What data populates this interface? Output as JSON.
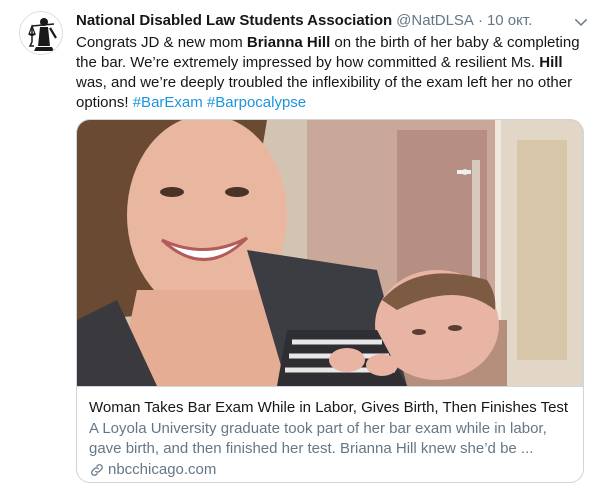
{
  "tweet": {
    "author_name": "National Disabled Law Students Association",
    "author_handle": "@NatDLSA",
    "separator": "·",
    "date": "10 окт.",
    "text_1": "Congrats JD & new mom ",
    "bold_1": "Brianna Hill",
    "text_2": " on the birth of her baby & completing the bar. We’re extremely impressed by how committed & resilient Ms. ",
    "bold_2": "Hill",
    "text_3": " was, and we’re deeply troubled the inflexibility of the exam left her no other options! ",
    "hashtag_1": "#BarExam",
    "hashtag_2": "#Barpocalypse"
  },
  "card": {
    "title": "Woman Takes Bar Exam While in Labor, Gives Birth, Then Finishes Test",
    "description": "A Loyola University graduate took part of her bar exam while in labor, gave birth, and then finished her test. Brianna Hill knew she’d be ...",
    "domain": "nbcchicago.com"
  },
  "icons": {
    "avatar": "scales-of-justice-logo",
    "caret": "chevron-down-icon",
    "link": "link-icon"
  },
  "colors": {
    "hashtag": "#1b95e0",
    "secondary_text": "#657786",
    "border": "#ccd6dd"
  }
}
